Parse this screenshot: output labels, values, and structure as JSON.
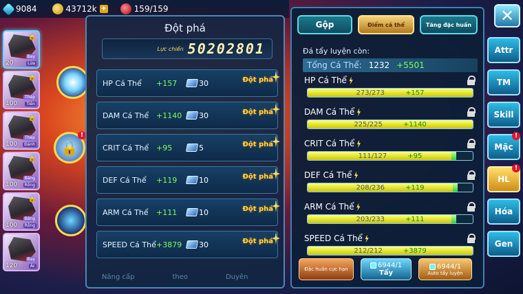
{
  "resources": {
    "gems": "9084",
    "gold": "43712k",
    "stamina": "159/159"
  },
  "heroes": [
    {
      "level": "20",
      "tag1": "Bay",
      "tag2": "Lửa"
    },
    {
      "level": "100",
      "tag1": "Thép",
      "tag2": "Tiên"
    },
    {
      "level": "100",
      "tag1": "Thép",
      "tag2": "Đánh"
    },
    {
      "level": "100",
      "tag1": "Băng",
      "tag2": "Rồng"
    },
    {
      "level": "100",
      "tag1": "Băng",
      "tag2": "Rồng"
    },
    {
      "level": "120",
      "tag1": "Bay",
      "tag2": "Ác"
    }
  ],
  "breakthrough": {
    "title": "Đột phá",
    "power_label": "Lực chiến",
    "power_value": "50202801",
    "button_label": "Đột phá",
    "rows": [
      {
        "name": "HP Cá Thể",
        "bonus": "+157",
        "cost": "30"
      },
      {
        "name": "DAM Cá Thể",
        "bonus": "+1140",
        "cost": "30"
      },
      {
        "name": "CRIT Cá Thể",
        "bonus": "+95",
        "cost": "5"
      },
      {
        "name": "DEF Cá Thể",
        "bonus": "+119",
        "cost": "10"
      },
      {
        "name": "ARM Cá Thể",
        "bonus": "+111",
        "cost": "10"
      },
      {
        "name": "SPEED Cá Thể",
        "bonus": "+3879",
        "cost": "30"
      }
    ],
    "bottom_labels": [
      "Nâng cấp",
      "theo",
      "Duyên"
    ]
  },
  "right": {
    "tabs": [
      "Gộp",
      "Điểm cá thể",
      "Tăng đặc huấn"
    ],
    "remaining_label": "Đá tẩy luyện còn:",
    "total_label": "Tổng Cá Thể:",
    "total_value": "1232",
    "total_bonus": "+5501",
    "stats": [
      {
        "name": "HP Cá Thể",
        "current": "273/273",
        "gain": "+157",
        "fill_pct": 100
      },
      {
        "name": "DAM Cá Thể",
        "current": "225/225",
        "gain": "+1140",
        "fill_pct": 100
      },
      {
        "name": "CRIT Cá Thể",
        "current": "111/127",
        "gain": "+95",
        "fill_pct": 87
      },
      {
        "name": "DEF Cá Thể",
        "current": "208/236",
        "gain": "+119",
        "fill_pct": 88
      },
      {
        "name": "ARM Cá Thể",
        "current": "203/233",
        "gain": "+111",
        "fill_pct": 87
      },
      {
        "name": "SPEED Cá Thể",
        "current": "212/212",
        "gain": "+3879",
        "fill_pct": 100
      }
    ],
    "actions": {
      "special_training": "Đặc huấn cực hạn",
      "wash_count": "6944/1",
      "wash_label": "Tẩy",
      "auto_count": "6944/1",
      "auto_label": "Auto tẩy luyện"
    }
  },
  "sidenav": [
    "Attr",
    "TM",
    "Skill",
    "Mặc",
    "HL",
    "Hóa",
    "Gen"
  ]
}
